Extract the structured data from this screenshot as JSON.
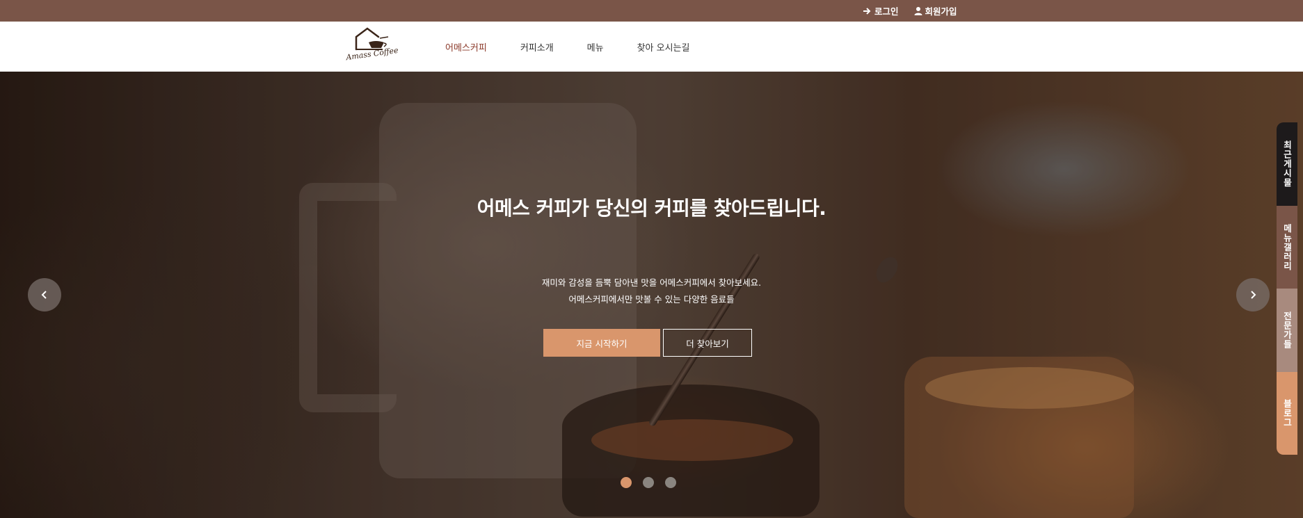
{
  "topbar": {
    "login_label": "로그인",
    "login_icon": "arrow-right-icon",
    "signup_label": "회원가입",
    "signup_icon": "user-icon"
  },
  "header": {
    "logo_text": "Amass Coffee",
    "nav": [
      {
        "label": "어메스커피",
        "active": true
      },
      {
        "label": "커피소개",
        "active": false
      },
      {
        "label": "메뉴",
        "active": false
      },
      {
        "label": "찾아 오시는길",
        "active": false
      }
    ]
  },
  "hero": {
    "title": "어메스 커피가 당신의 커피를 찾아드립니다.",
    "subtitle_lines": [
      "재미와 감성을 듬뿍 담아낸 맛을 어메스커피에서 찾아보세요.",
      "어메스커피에서만 맛볼 수 있는 다양한 음료들"
    ],
    "primary_button": "지금 시작하기",
    "secondary_button": "더 찾아보기",
    "prev_icon": "chevron-left-icon",
    "next_icon": "chevron-right-icon",
    "slide_count": 3,
    "active_slide": 1
  },
  "side_tabs": [
    {
      "label": "최근게시물"
    },
    {
      "label": "메뉴갤러리"
    },
    {
      "label": "전문가들"
    },
    {
      "label": "블로그"
    }
  ],
  "colors": {
    "topbar": "#7a5548",
    "accent": "#d9966c",
    "nav_active": "#8b3a2a",
    "side_tab_dark": "#1d1a1b",
    "side_tab_brown": "#7a5548",
    "side_tab_taupe": "#a88a7e",
    "side_tab_accent": "#d9966c"
  }
}
